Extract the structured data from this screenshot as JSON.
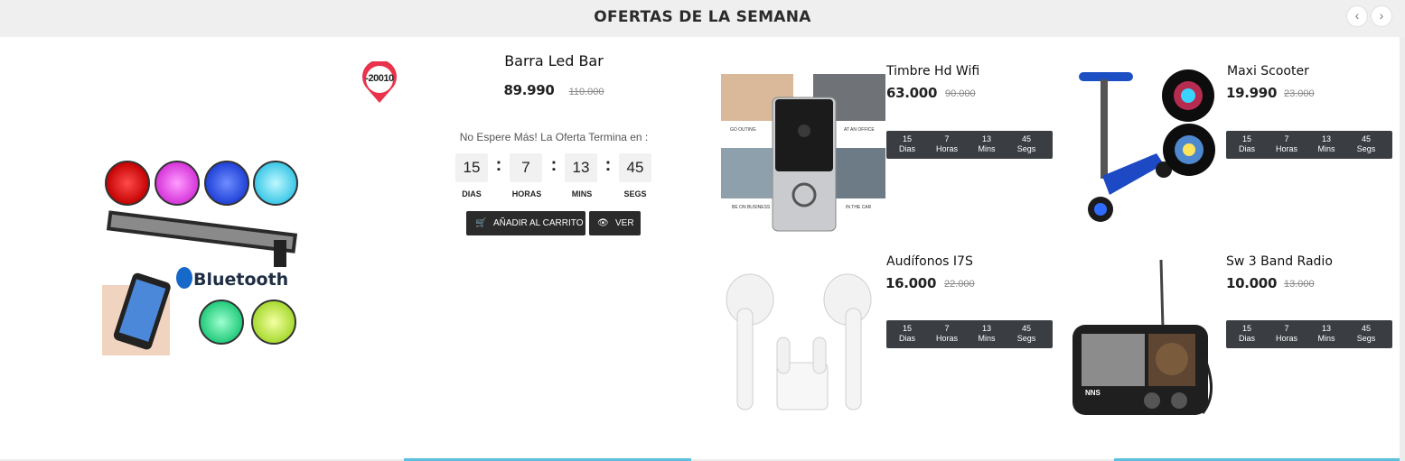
{
  "header": {
    "title": "OFERTAS DE LA SEMANA",
    "prev_icon": "‹",
    "next_icon": "›"
  },
  "featured": {
    "name": "Barra Led Bar",
    "price": "89.990",
    "old_price": "110.000",
    "badge": "-20010",
    "note": "No Espere Más! La Oferta Termina en :",
    "countdown": [
      {
        "value": "15",
        "label": "DIAS"
      },
      {
        "value": "7",
        "label": "HORAS"
      },
      {
        "value": "13",
        "label": "MINS"
      },
      {
        "value": "45",
        "label": "SEGS"
      }
    ],
    "separator": ":",
    "cart_label": "AÑADIR AL CARRITO",
    "view_label": "VER",
    "image_text": "Bluetooth"
  },
  "products": [
    {
      "name": "Timbre Hd Wifi",
      "price": "63.000",
      "old_price": "90.000",
      "timer": [
        {
          "value": "15",
          "label": "Dias"
        },
        {
          "value": "7",
          "label": "Horas"
        },
        {
          "value": "13",
          "label": "Mins"
        },
        {
          "value": "45",
          "label": "Segs"
        }
      ],
      "image_captions": [
        "GO OUTING",
        "AT AN OFFICE",
        "BE ON BUSINESS",
        "IN THE CAR"
      ]
    },
    {
      "name": "Maxi Scooter",
      "price": "19.990",
      "old_price": "23.000",
      "timer": [
        {
          "value": "15",
          "label": "Dias"
        },
        {
          "value": "7",
          "label": "Horas"
        },
        {
          "value": "13",
          "label": "Mins"
        },
        {
          "value": "45",
          "label": "Segs"
        }
      ]
    },
    {
      "name": "Audífonos I7S",
      "price": "16.000",
      "old_price": "22.000",
      "timer": [
        {
          "value": "15",
          "label": "Dias"
        },
        {
          "value": "7",
          "label": "Horas"
        },
        {
          "value": "13",
          "label": "Mins"
        },
        {
          "value": "45",
          "label": "Segs"
        }
      ]
    },
    {
      "name": "Sw 3 Band Radio",
      "price": "10.000",
      "old_price": "13.000",
      "timer": [
        {
          "value": "15",
          "label": "Dias"
        },
        {
          "value": "7",
          "label": "Horas"
        },
        {
          "value": "13",
          "label": "Mins"
        },
        {
          "value": "45",
          "label": "Segs"
        }
      ],
      "image_brand": "NNS"
    }
  ],
  "colors": {
    "header_bg": "#efefef",
    "dark_button": "#2b2b2b",
    "timer_bg": "#3a3d42",
    "accent": "#5bc0de",
    "badge_red": "#e8334a"
  }
}
